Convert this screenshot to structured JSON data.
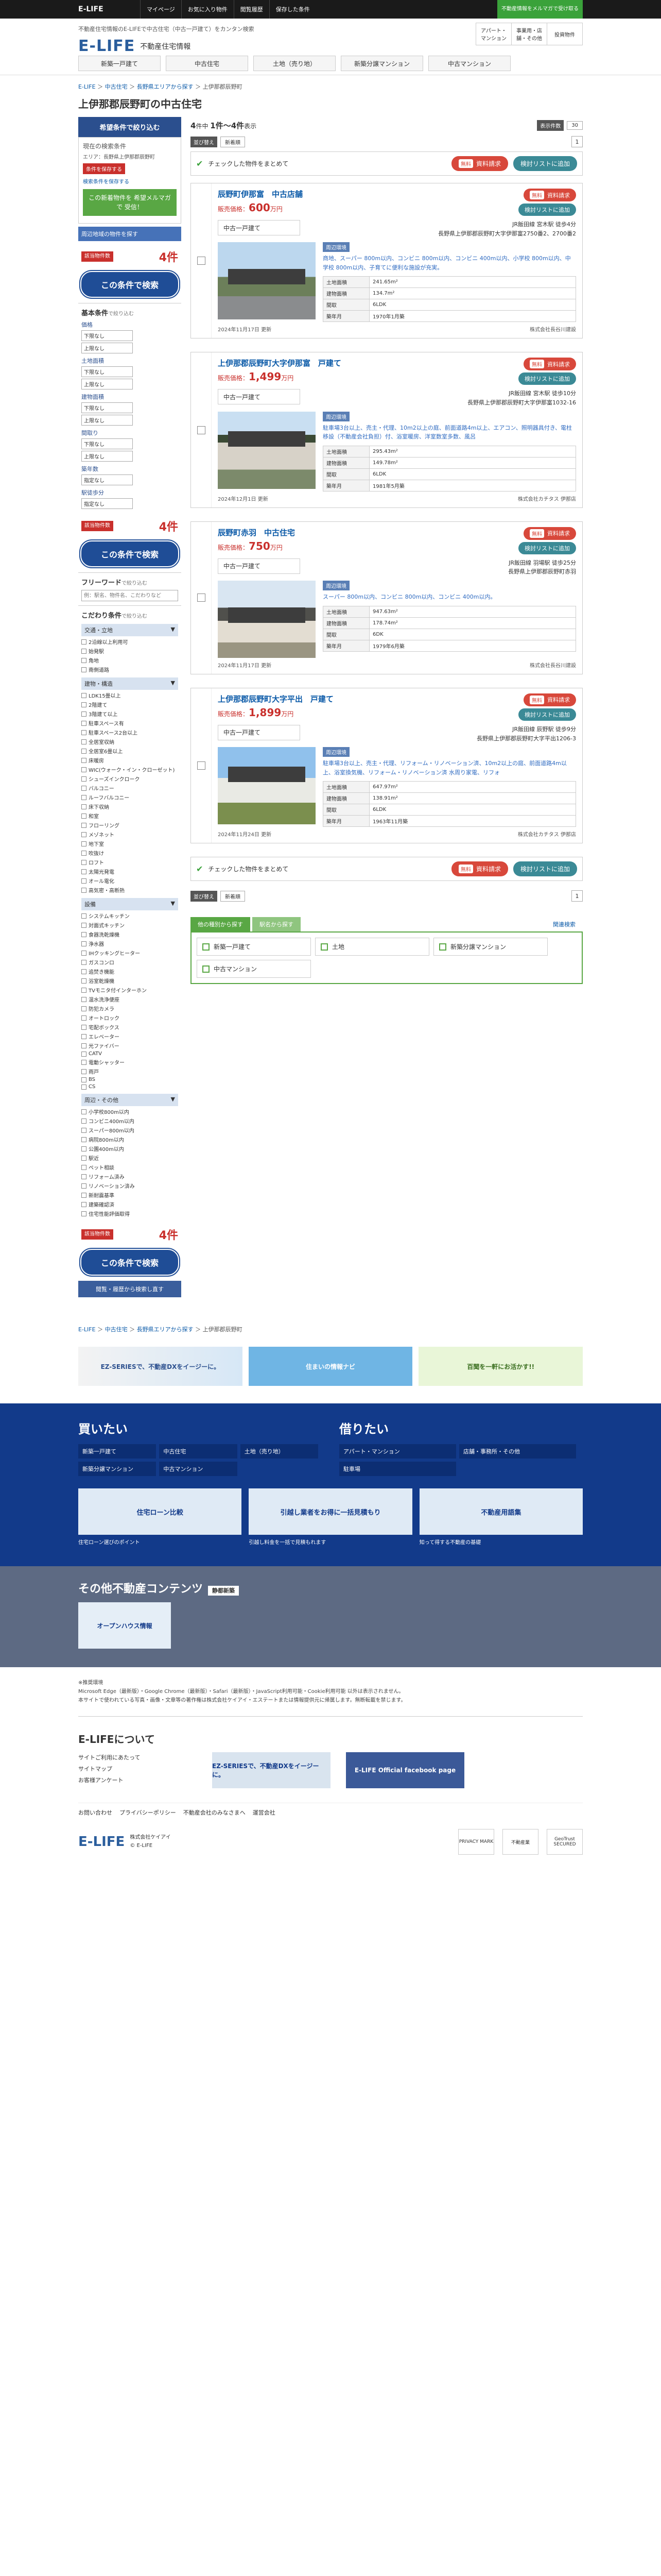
{
  "topbar": {
    "logo": "E-LIFE",
    "items": [
      "マイページ",
      "お気に入り物件",
      "閲覧履歴",
      "保存した条件"
    ],
    "green": "不動産情報をメルマガで受け取る"
  },
  "header": {
    "desc": "不動産住宅情報のE-LIFEで中古住宅（中古一戸建て）をカンタン検索",
    "logo": "E-LIFE",
    "logo_sub": "不動産住宅情報",
    "right": [
      "アパート・マンション",
      "事業用・店舗・その他",
      "投資物件"
    ],
    "nav": [
      "新築一戸建て",
      "中古住宅",
      "土地（売り地）",
      "新築分譲マンション",
      "中古マンション"
    ]
  },
  "breadcrumb": [
    "E-LIFE",
    "中古住宅",
    "長野県エリアから探す",
    "上伊那郡辰野町"
  ],
  "page_title": "上伊那郡辰野町の中古住宅",
  "sidebar": {
    "head": "希望条件で絞り込む",
    "current_title": "現在の検索条件",
    "current_text": "エリア：長野県上伊那郡辰野町",
    "clear": "条件を保存する",
    "mail_link": "検索条件を保存する",
    "green": "この新着物件を 希望メルマガで 受信！",
    "blue_link": "周辺地域の物件を探す",
    "count_badge": "該当物件数",
    "count": "4件",
    "search_btn": "この条件で検索",
    "basic": "基本条件",
    "basic_sub": "で絞り込む",
    "price_label": "価格",
    "land_label": "土地面積",
    "bldg_label": "建物面積",
    "layout_label": "間取り",
    "age_label": "築年数",
    "walk_label": "駅徒歩分",
    "select_lower": "下限なし",
    "select_upper": "上限なし",
    "select_none": "指定なし",
    "free_title": "フリーワード",
    "free_sub": "で絞り込む",
    "free_placeholder": "例：駅名、物件名、こだわりなど",
    "kodawari": "こだわり条件",
    "kodawari_sub": "で絞り込む",
    "cat1": "交通・立地",
    "cat1_items": [
      "2沿線以上利用可",
      "始発駅",
      "角地",
      "南側道路"
    ],
    "cat2": "建物・構造",
    "cat2_items": [
      "LDK15畳以上",
      "2階建て",
      "3階建て以上",
      "駐車スペース有",
      "駐車スペース2台以上",
      "全居室収納",
      "全居室6畳以上",
      "床暖房",
      "WIC(ウォーク・イン・クローゼット)",
      "シューズインクローク",
      "バルコニー",
      "ルーフバルコニー",
      "床下収納",
      "和室",
      "フローリング",
      "メゾネット",
      "地下室",
      "吹抜け",
      "ロフト",
      "太陽光発電",
      "オール電化",
      "高気密・高断熱"
    ],
    "cat3": "設備",
    "cat3_items": [
      "システムキッチン",
      "対面式キッチン",
      "食器洗乾燥機",
      "浄水器",
      "IHクッキングヒーター",
      "ガスコンロ",
      "追焚き機能",
      "浴室乾燥機",
      "TVモニタ付インターホン",
      "温水洗浄便座",
      "防犯カメラ",
      "オートロック",
      "宅配ボックス",
      "エレベーター",
      "光ファイバー",
      "CATV",
      "電動シャッター",
      "雨戸",
      "BS",
      "CS"
    ],
    "cat4": "周辺・その他",
    "cat4_items": [
      "小学校800m以内",
      "コンビニ400m以内",
      "スーパー800m以内",
      "病院800m以内",
      "公園400m以内",
      "駅近",
      "ペット相談",
      "リフォーム済み",
      "リノベーション済み",
      "新耐震基準",
      "建築確認済",
      "住宅性能評価取得"
    ],
    "bottom_link": "閲覧・履歴から検索し直す"
  },
  "results": {
    "count_text_pre": "件中",
    "total": "4",
    "range": "1件～4件",
    "range_suffix": "表示",
    "disp_label": "表示件数",
    "disp_val": "30",
    "sort_label": "並び替え",
    "sort_val": "新着順",
    "page": "1",
    "bulk_text": "チェックした物件をまとめて",
    "free_tag": "無料",
    "request_btn": "資料請求",
    "fav_btn": "検討リストに追加"
  },
  "properties": [
    {
      "name": "辰野町伊那富　中古店舗",
      "price_label": "販売価格",
      "price": "600",
      "unit": "万円",
      "kind": "中古一戸建て",
      "access1": "JR飯田線 宮木駅 徒歩4分",
      "access2": "長野県上伊那郡辰野町大字伊那富2750番2、2700番2",
      "tag": "周辺環境",
      "feature": "商地、スーパー 800m以内、コンビニ 800m以内、コンビニ 400m以内、小学校 800m以内、中学校 800m以内、子育てに便利な施設が充実。",
      "spec": [
        [
          "土地面積",
          "241.65m²"
        ],
        [
          "建物面積",
          "134.7m²"
        ],
        [
          "間取",
          "6LDK"
        ],
        [
          "築年月",
          "1970年1月築"
        ]
      ],
      "date": "2024年11月17日 更新",
      "company": "株式会社長谷川建設"
    },
    {
      "name": "上伊那郡辰野町大字伊那富　戸建て",
      "price_label": "販売価格",
      "price": "1,499",
      "unit": "万円",
      "kind": "中古一戸建て",
      "access1": "JR飯田線 宮木駅 徒歩10分",
      "access2": "長野県上伊那郡辰野町大字伊那富1032-16",
      "tag": "周辺環境",
      "feature": "駐車場3台以上、売主・代理、10m2以上の庭、前面道路4m以上、エアコン、照明器具付き、電柱移設（不動産会社負担）付、浴室暖房、洋室数室多数、風呂",
      "spec": [
        [
          "土地面積",
          "295.43m²"
        ],
        [
          "建物面積",
          "149.78m²"
        ],
        [
          "間取",
          "6LDK"
        ],
        [
          "築年月",
          "1981年5月築"
        ]
      ],
      "date": "2024年12月1日 更新",
      "company": "株式会社カチタス 伊那店"
    },
    {
      "name": "辰野町赤羽　中古住宅",
      "price_label": "販売価格",
      "price": "750",
      "unit": "万円",
      "kind": "中古一戸建て",
      "access1": "JR飯田線 羽場駅 徒歩25分",
      "access2": "長野県上伊那郡辰野町赤羽",
      "tag": "周辺環境",
      "feature": "スーパー 800m以内、コンビニ 800m以内、コンビニ 400m以内。",
      "spec": [
        [
          "土地面積",
          "947.63m²"
        ],
        [
          "建物面積",
          "178.74m²"
        ],
        [
          "間取",
          "6DK"
        ],
        [
          "築年月",
          "1979年6月築"
        ]
      ],
      "date": "2024年11月17日 更新",
      "company": "株式会社長谷川建設"
    },
    {
      "name": "上伊那郡辰野町大字平出　戸建て",
      "price_label": "販売価格",
      "price": "1,899",
      "unit": "万円",
      "kind": "中古一戸建て",
      "access1": "JR飯田線 辰野駅 徒歩9分",
      "access2": "長野県上伊那郡辰野町大字平出1206-3",
      "tag": "周辺環境",
      "feature": "駐車場3台以上、売主・代理、リフォーム・リノベーション済、10m2以上の庭、前面道路4m以上、浴室換気機、リフォーム・リノベーション済 水周り家電、リフォ",
      "spec": [
        [
          "土地面積",
          "647.97m²"
        ],
        [
          "建物面積",
          "138.91m²"
        ],
        [
          "間取",
          "6LDK"
        ],
        [
          "築年月",
          "1963年11月築"
        ]
      ],
      "date": "2024年11月24日 更新",
      "company": "株式会社カチタス 伊那店"
    }
  ],
  "other_search": {
    "tabs": [
      "他の種別から探す",
      "駅名から探す"
    ],
    "right": "関連検索",
    "items": [
      "新築一戸建て",
      "土地",
      "新築分譲マンション",
      "中古マンション"
    ]
  },
  "banners": [
    "EZ-SERIESで、不動産DXをイージーに。",
    "住まいの情報ナビ",
    "百聞を一軒にお活かす!!"
  ],
  "footer_nav": {
    "buy_title": "買いたい",
    "buy_links": [
      "新築一戸建て",
      "中古住宅",
      "土地（売り地）",
      "新築分譲マンション",
      "中古マンション"
    ],
    "rent_title": "借りたい",
    "rent_links": [
      "アパート・マンション",
      "店舗・事務所・その他",
      "駐車場"
    ],
    "imgs": [
      "住宅ローン比較",
      "引越し業者をお得に一括見積もり",
      "不動産用語集"
    ],
    "img_caps": [
      "住宅ローン選びのポイント",
      "引越し料金を一括で見積もれます",
      "知って得する不動産の基礎"
    ]
  },
  "other_contents": {
    "title": "その他不動産コンテンツ",
    "badge": "静都新築",
    "img": "オープンハウス情報"
  },
  "notes": [
    "※推奨環境",
    "Microsoft Edge（最新版）・Google Chrome（最新版）・Safari（最新版）・JavaScript利用可能・Cookie利用可能 以外は表示されません。",
    "本サイトで使われている写真・画像・文章等の著作権は株式会社ケイアイ・エステートまたは情報提供元に帰属します。無断転載を禁じます。"
  ],
  "about": {
    "title": "E-LIFEについて",
    "links": [
      "サイトご利用にあたって",
      "サイトマップ",
      "お客様アンケート"
    ],
    "b1": "EZ-SERIESで、不動産DXをイージーに。",
    "b2": "E-LIFE Official facebook page"
  },
  "flinks": [
    "お問い合わせ",
    "プライバシーポリシー",
    "不動産会社のみなさまへ",
    "運営会社"
  ],
  "corp": {
    "logo": "E-LIFE",
    "name": "株式会社ケイアイ",
    "copy": "© E-LIFE",
    "seals": [
      "PRIVACY MARK",
      "不動産業",
      "GeoTrust SECURED"
    ]
  },
  "colors": {
    "primary": "#2b4f8e",
    "accent": "#c9302c",
    "green": "#59a744",
    "navy": "#123a8a"
  }
}
